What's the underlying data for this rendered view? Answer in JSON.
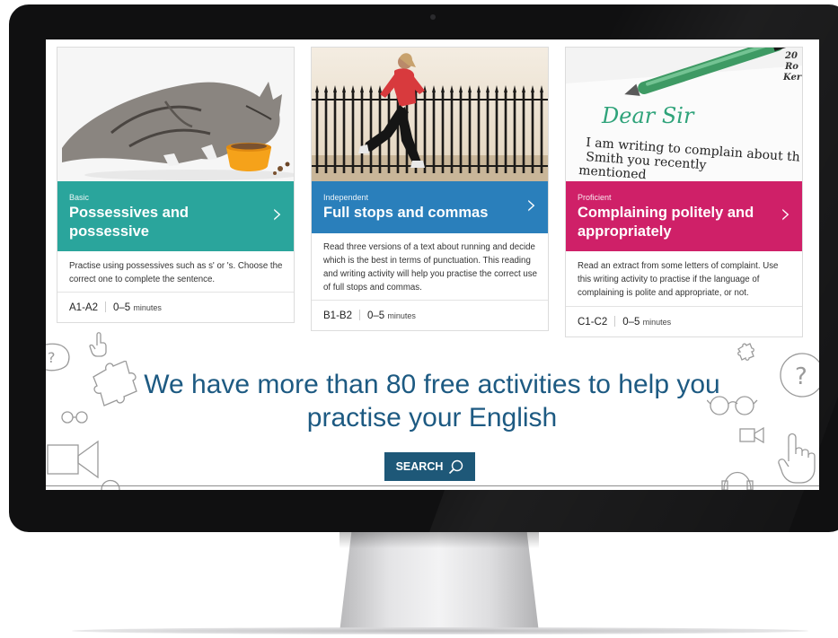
{
  "cards": [
    {
      "level": "Basic",
      "title": "Possessives and possessive",
      "description": "Practise using possessives such as s' or 's. Choose the correct one to complete the sentence.",
      "code": "A1-A2",
      "duration": "0–5",
      "duration_unit": "minutes",
      "image": "cat-eating-photo",
      "color": "#2aa59c"
    },
    {
      "level": "Independent",
      "title": "Full stops and commas",
      "description": "Read three versions of a text about running and decide which is the best in terms of punctuation. This reading and writing activity will help you practise the correct use of full stops and commas.",
      "code": "B1-B2",
      "duration": "0–5",
      "duration_unit": "minutes",
      "image": "woman-running-photo",
      "color": "#2a7fbb"
    },
    {
      "level": "Proficient",
      "title": "Complaining politely and appropriately",
      "description": "Read an extract from some letters of complaint. Use this writing activity to practise if the language of complaining is polite and appropriate, or not.",
      "code": "C1-C2",
      "duration": "0–5",
      "duration_unit": "minutes",
      "image": "letter-and-pen-photo",
      "color": "#cf2068",
      "letter_text": {
        "salutation": "Dear Sir",
        "line1": "I am writing to complain about th",
        "line2": "Smith you recently",
        "line3": "mentioned",
        "corner": "20",
        "corner2": "Ro",
        "corner3": "Ker"
      }
    }
  ],
  "chevron": "›",
  "headline": "We have more than 80 free activities to help you practise your English",
  "search_label": "SEARCH",
  "icons": [
    "question-bubble-icon",
    "pointer-hand-icon",
    "puzzle-icon",
    "glasses-icon",
    "video-camera-icon",
    "headphones-icon",
    "search-icon"
  ]
}
